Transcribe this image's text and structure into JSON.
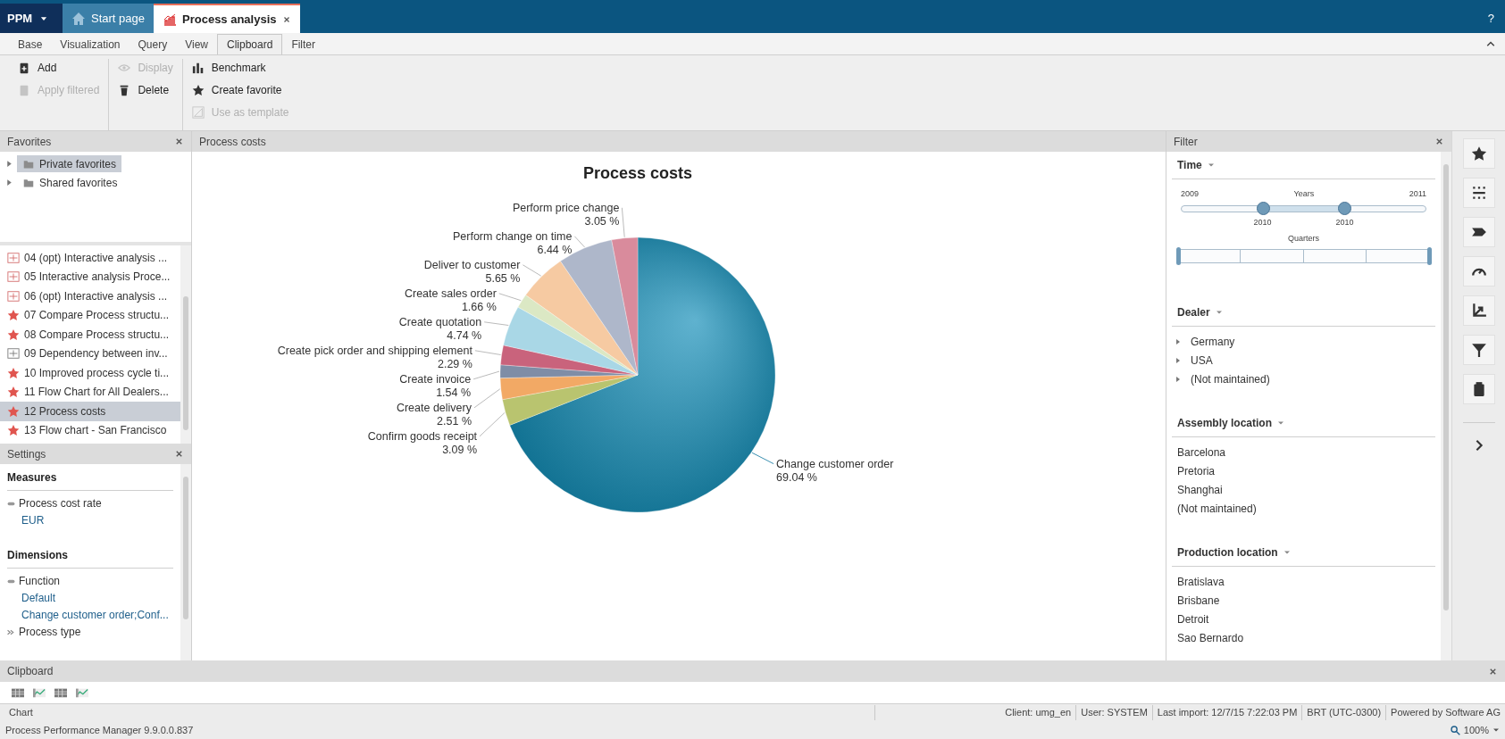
{
  "app_bar": {
    "menu": "PPM",
    "help": "?",
    "tabs": [
      {
        "label": "Start page",
        "selected": false
      },
      {
        "label": "Process analysis",
        "selected": true
      }
    ]
  },
  "ribbon": {
    "tabs": [
      {
        "label": "Base",
        "selected": false
      },
      {
        "label": "Visualization",
        "selected": false
      },
      {
        "label": "Query",
        "selected": false
      },
      {
        "label": "View",
        "selected": false
      },
      {
        "label": "Clipboard",
        "selected": true
      },
      {
        "label": "Filter",
        "selected": false
      }
    ],
    "groups": [
      [
        {
          "label": "Add",
          "disabled": false
        },
        {
          "label": "Apply filtered",
          "disabled": true
        }
      ],
      [
        {
          "label": "Display",
          "disabled": true
        },
        {
          "label": "Delete",
          "disabled": false
        }
      ],
      [
        {
          "label": "Benchmark",
          "disabled": false
        },
        {
          "label": "Create favorite",
          "disabled": false
        },
        {
          "label": "Use as template",
          "disabled": true
        }
      ]
    ]
  },
  "favorites": {
    "title": "Favorites",
    "folders": [
      {
        "label": "Private favorites",
        "selected": true,
        "expanded": false
      },
      {
        "label": "Shared favorites",
        "selected": false,
        "expanded": false
      }
    ],
    "items": [
      {
        "label": "04 (opt) Interactive analysis ...",
        "kind": "report",
        "selected": false
      },
      {
        "label": "05 Interactive analysis Proce...",
        "kind": "report",
        "selected": false
      },
      {
        "label": "06 (opt) Interactive analysis ...",
        "kind": "report",
        "selected": false
      },
      {
        "label": "07 Compare Process structu...",
        "kind": "favorite",
        "selected": false
      },
      {
        "label": "08 Compare Process structu...",
        "kind": "favorite",
        "selected": false
      },
      {
        "label": "09 Dependency between inv...",
        "kind": "table",
        "selected": false
      },
      {
        "label": "10 Improved process cycle ti...",
        "kind": "favorite",
        "selected": false
      },
      {
        "label": "11 Flow Chart for All Dealers...",
        "kind": "favorite",
        "selected": false
      },
      {
        "label": "12 Process costs",
        "kind": "favorite",
        "selected": true
      },
      {
        "label": "13 Flow chart - San Francisco",
        "kind": "favorite",
        "selected": false
      }
    ]
  },
  "settings": {
    "title": "Settings",
    "sections": [
      {
        "heading": "Measures",
        "items": [
          {
            "label": "Process cost rate",
            "kind": "field"
          },
          {
            "label": "EUR",
            "kind": "value"
          }
        ]
      },
      {
        "heading": "Dimensions",
        "items": [
          {
            "label": "Function",
            "kind": "field"
          },
          {
            "label": "Default",
            "kind": "value"
          },
          {
            "label": "Change customer order;Conf...",
            "kind": "value"
          },
          {
            "label": "Process type",
            "kind": "more"
          }
        ]
      }
    ]
  },
  "chart_panel": {
    "title": "Process costs",
    "chart_data": {
      "type": "pie",
      "title": "Process costs",
      "categories": [
        "Change customer order",
        "Confirm goods receipt",
        "Create delivery",
        "Create invoice",
        "Create pick order and shipping element",
        "Create quotation",
        "Create sales order",
        "Deliver to customer",
        "Perform change on time",
        "Perform price change"
      ],
      "values": [
        69.04,
        3.09,
        2.51,
        1.54,
        2.29,
        4.74,
        1.66,
        5.65,
        6.44,
        3.05
      ],
      "value_labels": [
        "69.04 %",
        "3.09 %",
        "2.51 %",
        "1.54 %",
        "2.29 %",
        "4.74 %",
        "1.66 %",
        "5.65 %",
        "6.44 %",
        "3.05 %"
      ]
    }
  },
  "filter": {
    "title": "Filter",
    "time": {
      "heading": "Time",
      "years": {
        "caption": "Years",
        "min": "2009",
        "max": "2011",
        "thumbs": [
          {
            "label": "2010",
            "level": 0.333
          },
          {
            "label": "2010",
            "level": 0.667
          }
        ]
      },
      "quarters": {
        "caption": "Quarters",
        "thumbs": [
          {
            "level": 0
          },
          {
            "level": 1
          }
        ]
      }
    },
    "groups": [
      {
        "heading": "Dealer",
        "items": [
          {
            "label": "Germany",
            "expanded": false
          },
          {
            "label": "USA",
            "expanded": false
          },
          {
            "label": "(Not maintained)",
            "expanded": false
          }
        ]
      },
      {
        "heading": "Assembly location",
        "items": [
          {
            "label": "Barcelona"
          },
          {
            "label": "Pretoria"
          },
          {
            "label": "Shanghai"
          },
          {
            "label": "(Not maintained)"
          }
        ]
      },
      {
        "heading": "Production location",
        "items": [
          {
            "label": "Bratislava"
          },
          {
            "label": "Brisbane"
          },
          {
            "label": "Detroit"
          },
          {
            "label": "Sao Bernardo"
          }
        ]
      }
    ]
  },
  "clipboard": {
    "title": "Clipboard"
  },
  "status_bar": {
    "left": "Chart",
    "segments": [
      "Client: umg_en",
      "User: SYSTEM",
      "Last import: 12/7/15 7:22:03 PM",
      "BRT (UTC-0300)",
      "Powered by Software AG"
    ]
  },
  "footer": {
    "version": "Process Performance Manager 9.9.0.0.837",
    "zoom": "100%"
  }
}
